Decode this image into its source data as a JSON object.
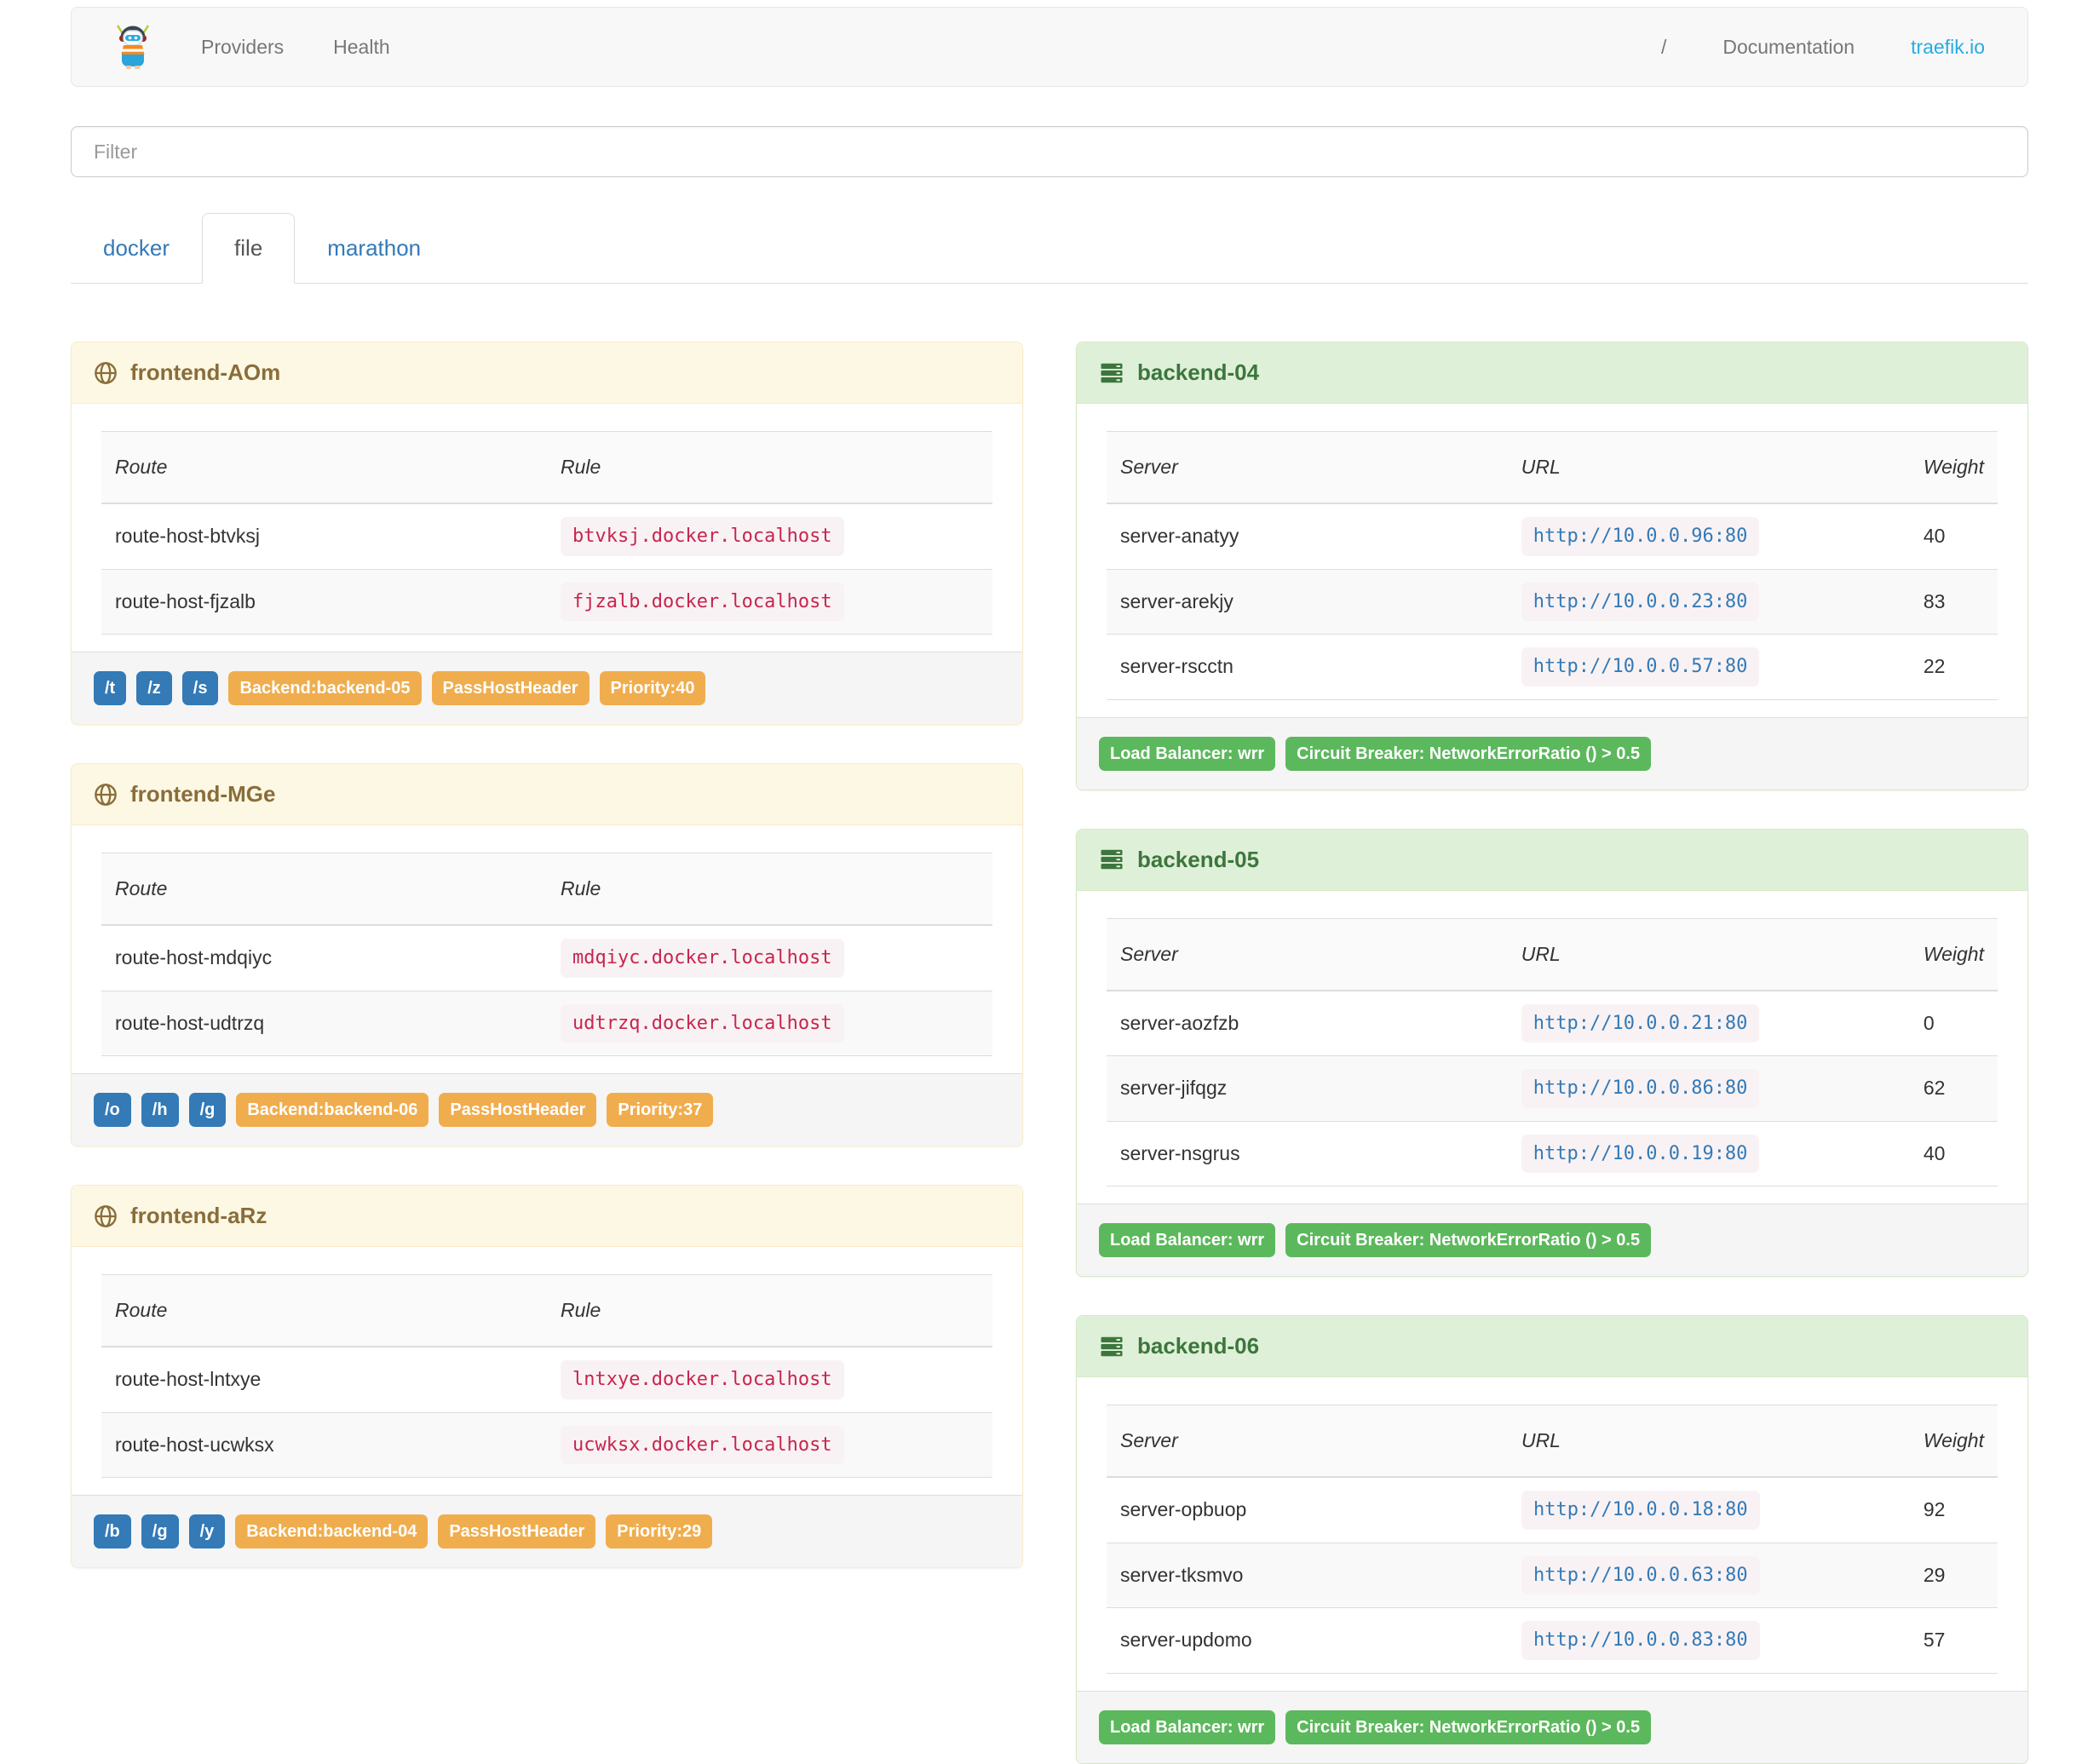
{
  "navbar": {
    "providers_label": "Providers",
    "health_label": "Health",
    "separator": "/",
    "documentation_label": "Documentation",
    "site_link_label": "traefik.io"
  },
  "filter": {
    "placeholder": "Filter"
  },
  "tabs": {
    "items": [
      {
        "label": "docker",
        "active": false
      },
      {
        "label": "file",
        "active": true
      },
      {
        "label": "marathon",
        "active": false
      }
    ]
  },
  "frontends": [
    {
      "title": "frontend-AOm",
      "columns": [
        "Route",
        "Rule"
      ],
      "routes": [
        {
          "route": "route-host-btvksj",
          "rule": "btvksj.docker.localhost"
        },
        {
          "route": "route-host-fjzalb",
          "rule": "fjzalb.docker.localhost"
        }
      ],
      "entrypoints": [
        "/t",
        "/z",
        "/s"
      ],
      "badges": [
        "Backend:backend-05",
        "PassHostHeader",
        "Priority:40"
      ]
    },
    {
      "title": "frontend-MGe",
      "columns": [
        "Route",
        "Rule"
      ],
      "routes": [
        {
          "route": "route-host-mdqiyc",
          "rule": "mdqiyc.docker.localhost"
        },
        {
          "route": "route-host-udtrzq",
          "rule": "udtrzq.docker.localhost"
        }
      ],
      "entrypoints": [
        "/o",
        "/h",
        "/g"
      ],
      "badges": [
        "Backend:backend-06",
        "PassHostHeader",
        "Priority:37"
      ]
    },
    {
      "title": "frontend-aRz",
      "columns": [
        "Route",
        "Rule"
      ],
      "routes": [
        {
          "route": "route-host-lntxye",
          "rule": "lntxye.docker.localhost"
        },
        {
          "route": "route-host-ucwksx",
          "rule": "ucwksx.docker.localhost"
        }
      ],
      "entrypoints": [
        "/b",
        "/g",
        "/y"
      ],
      "badges": [
        "Backend:backend-04",
        "PassHostHeader",
        "Priority:29"
      ]
    }
  ],
  "backends": [
    {
      "title": "backend-04",
      "columns": [
        "Server",
        "URL",
        "Weight"
      ],
      "servers": [
        {
          "name": "server-anatyy",
          "url": "http://10.0.0.96:80",
          "weight": "40"
        },
        {
          "name": "server-arekjy",
          "url": "http://10.0.0.23:80",
          "weight": "83"
        },
        {
          "name": "server-rscctn",
          "url": "http://10.0.0.57:80",
          "weight": "22"
        }
      ],
      "badges": [
        "Load Balancer: wrr",
        "Circuit Breaker: NetworkErrorRatio () > 0.5"
      ]
    },
    {
      "title": "backend-05",
      "columns": [
        "Server",
        "URL",
        "Weight"
      ],
      "servers": [
        {
          "name": "server-aozfzb",
          "url": "http://10.0.0.21:80",
          "weight": "0"
        },
        {
          "name": "server-jifqgz",
          "url": "http://10.0.0.86:80",
          "weight": "62"
        },
        {
          "name": "server-nsgrus",
          "url": "http://10.0.0.19:80",
          "weight": "40"
        }
      ],
      "badges": [
        "Load Balancer: wrr",
        "Circuit Breaker: NetworkErrorRatio () > 0.5"
      ]
    },
    {
      "title": "backend-06",
      "columns": [
        "Server",
        "URL",
        "Weight"
      ],
      "servers": [
        {
          "name": "server-opbuop",
          "url": "http://10.0.0.18:80",
          "weight": "92"
        },
        {
          "name": "server-tksmvo",
          "url": "http://10.0.0.63:80",
          "weight": "29"
        },
        {
          "name": "server-updomo",
          "url": "http://10.0.0.83:80",
          "weight": "57"
        }
      ],
      "badges": [
        "Load Balancer: wrr",
        "Circuit Breaker: NetworkErrorRatio () > 0.5"
      ]
    }
  ],
  "icons": {
    "brand": "traefik-logo-icon",
    "frontend": "globe-icon",
    "backend": "server-stack-icon"
  },
  "colors": {
    "frontend_header_bg": "#fcf8e3",
    "frontend_title": "#8a6d3b",
    "backend_header_bg": "#dff0d8",
    "backend_title": "#3c763d",
    "label_blue": "#337ab7",
    "label_orange": "#f0ad4e",
    "label_green": "#5cb85c",
    "rule_code_text": "#c7254e",
    "url_link_text": "#337ab7",
    "tab_link": "#337ab7",
    "site_link": "#29abe2"
  }
}
